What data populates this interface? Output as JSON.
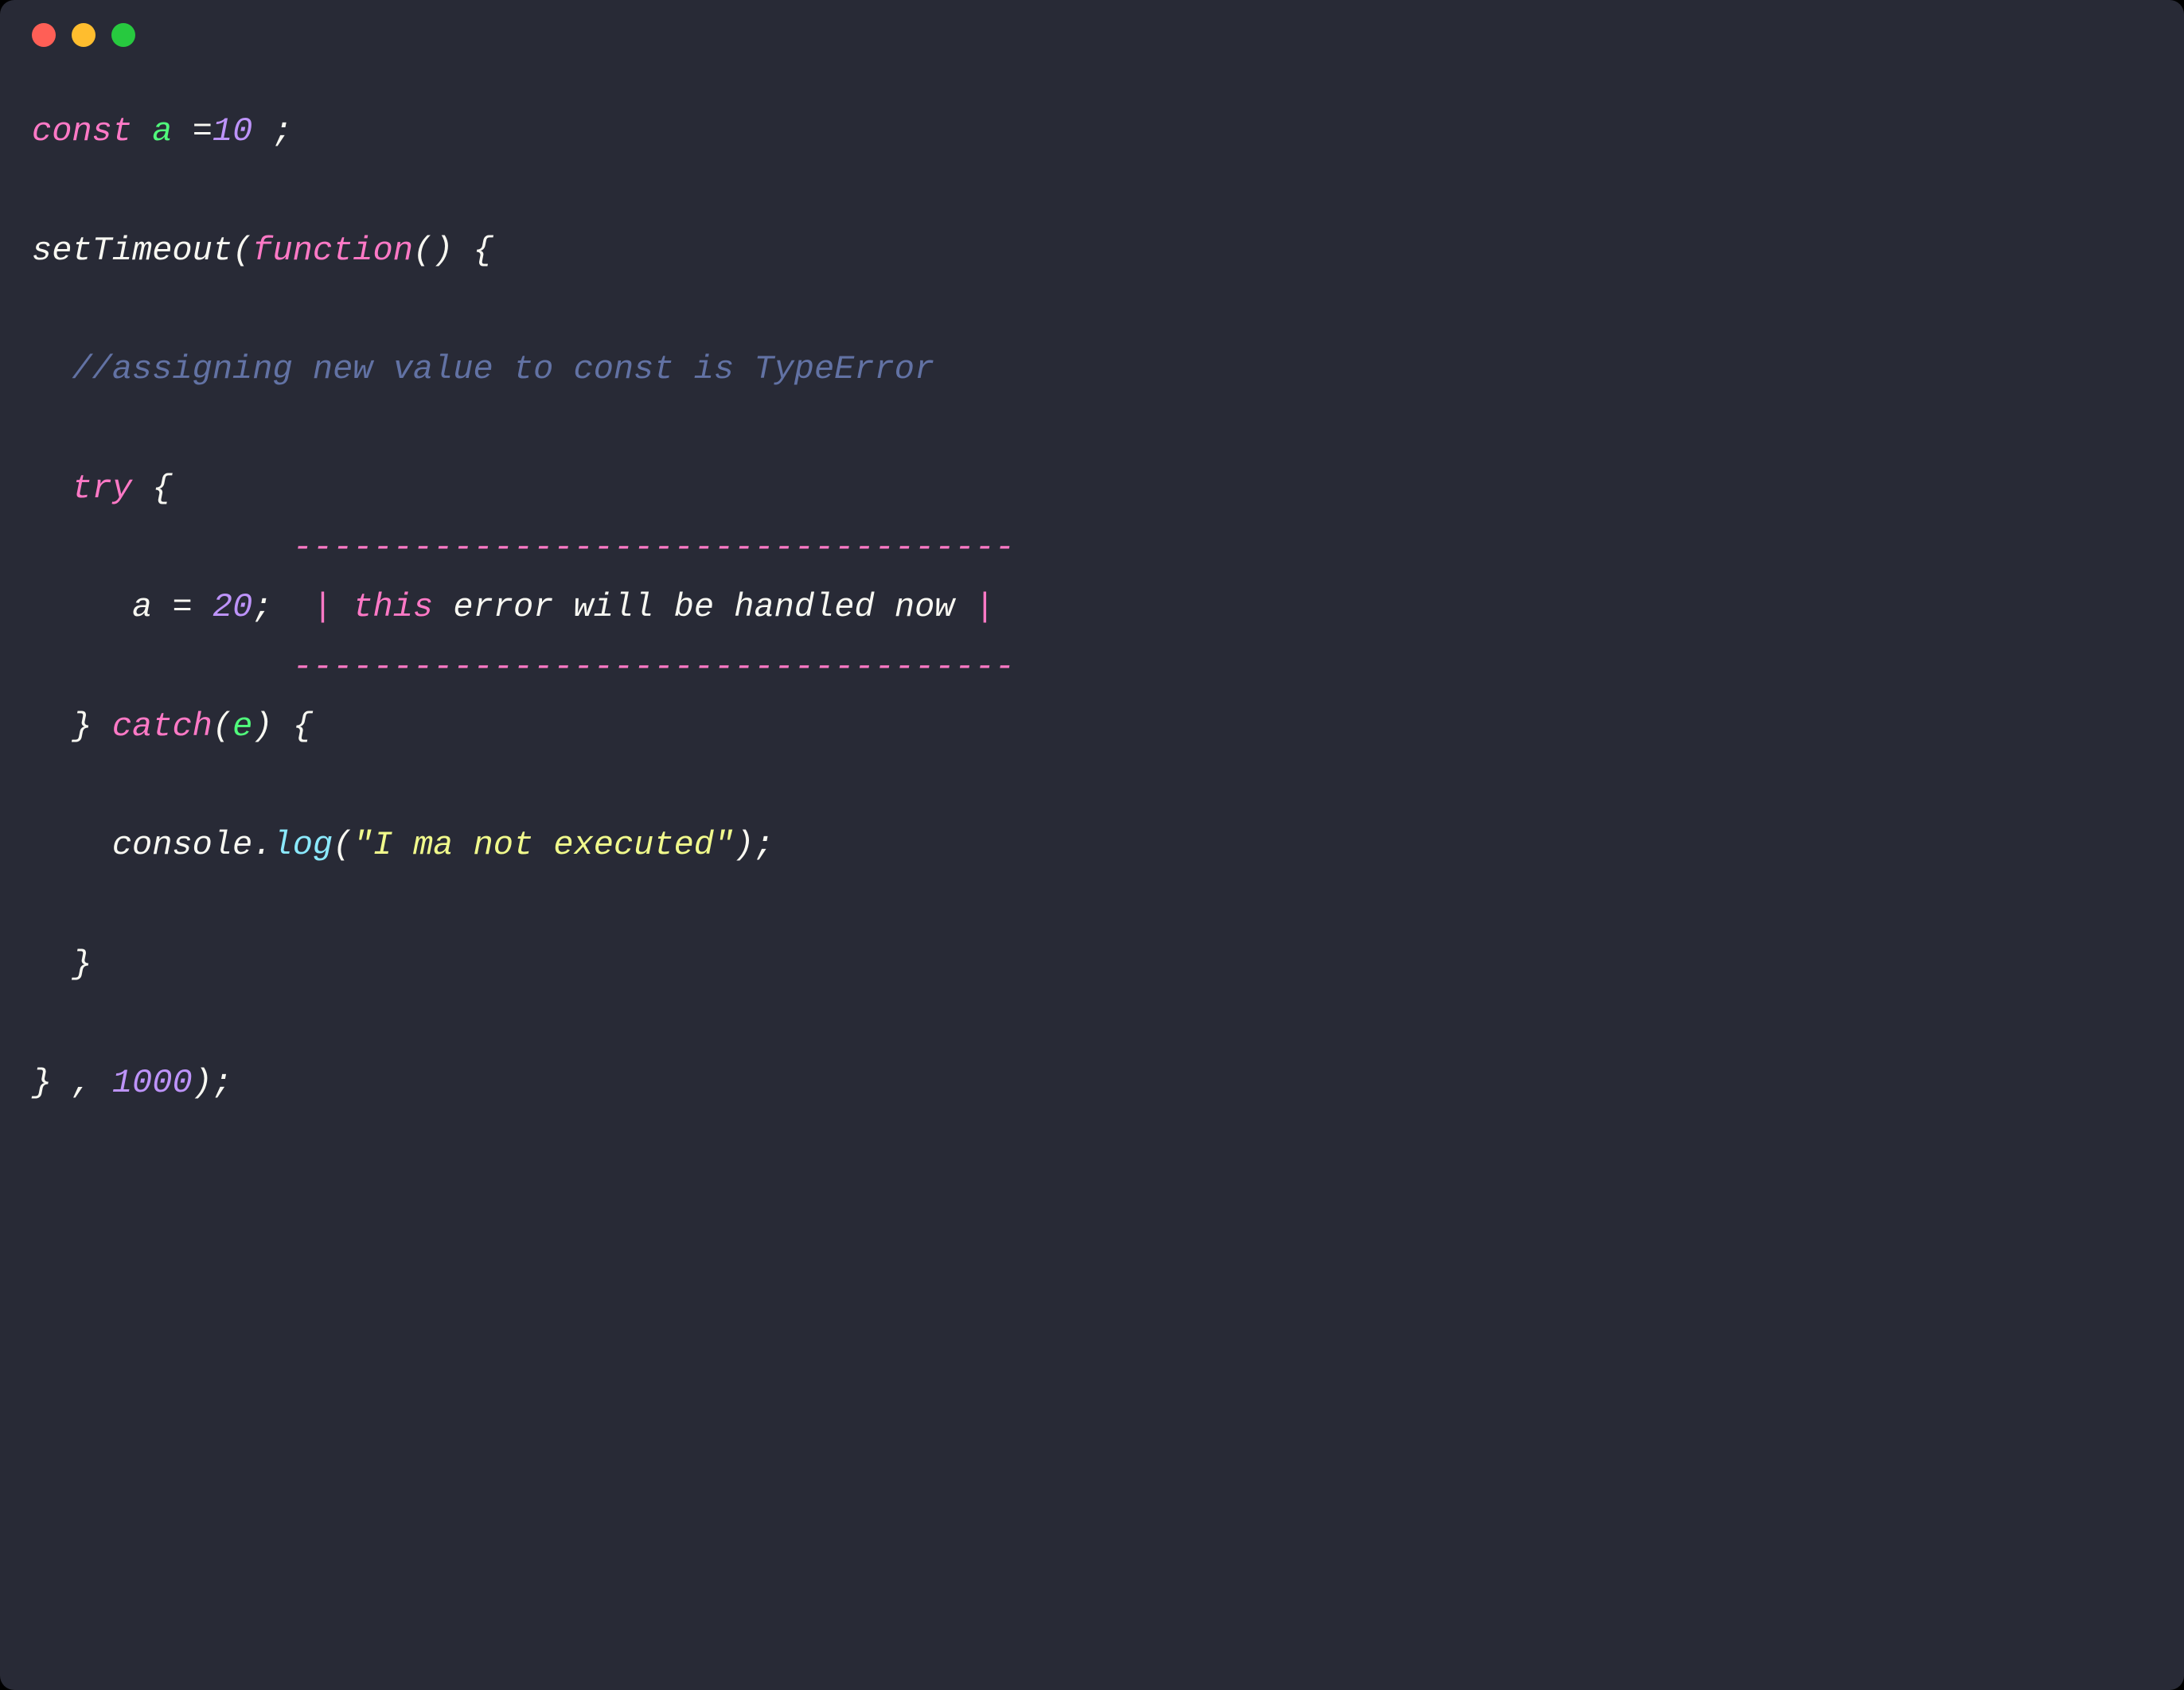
{
  "window": {
    "traffic_lights": [
      "close",
      "minimize",
      "zoom"
    ]
  },
  "code": {
    "l1": {
      "const": "const",
      "a": "a",
      "eq": "=",
      "ten": "10",
      "semi": " ;"
    },
    "l3": {
      "setTimeout": "setTimeout",
      "open": "(",
      "function": "function",
      "rest": "() {"
    },
    "l5": {
      "comment": "//assigning new value to const is TypeError"
    },
    "l7": {
      "try": "try",
      "brace": " {"
    },
    "l8": {
      "dashes_top": "------------------------------------"
    },
    "l9": {
      "a": "a",
      "eq": " = ",
      "twenty": "20",
      "semi": ";",
      "pipe1": "  | ",
      "this": "this",
      "msg": " error will be handled now ",
      "pipe2": "|"
    },
    "l10": {
      "dashes_bot": "------------------------------------"
    },
    "l11": {
      "close": "} ",
      "catch": "catch",
      "open": "(",
      "e": "e",
      "rest": ") {"
    },
    "l13": {
      "console": "console",
      "dot": ".",
      "log": "log",
      "open": "(",
      "str": "\"I ma not executed\"",
      "close": ");"
    },
    "l15": {
      "brace": "}"
    },
    "l17": {
      "brace": "}",
      "comma": " , ",
      "thousand": "1000",
      "close": ");"
    }
  }
}
